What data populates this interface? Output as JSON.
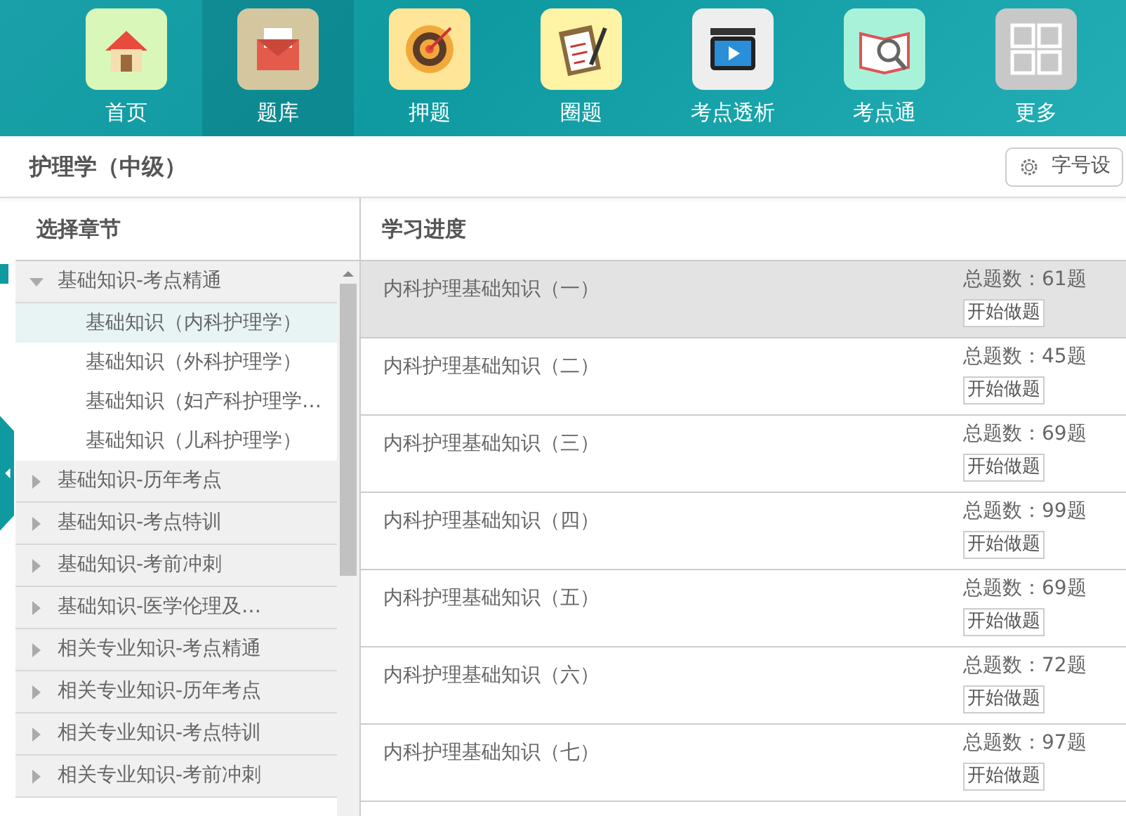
{
  "nav": [
    {
      "label": "首页",
      "selected": false
    },
    {
      "label": "题库",
      "selected": true
    },
    {
      "label": "押题",
      "selected": false
    },
    {
      "label": "圈题",
      "selected": false
    },
    {
      "label": "考点透析",
      "selected": false
    },
    {
      "label": "考点通",
      "selected": false
    },
    {
      "label": "更多",
      "selected": false
    }
  ],
  "page_title": "护理学（中级）",
  "font_size_button": "字号设",
  "sidebar": {
    "heading": "选择章节",
    "items": [
      {
        "label": "基础知识-考点精通",
        "expanded": true,
        "children": [
          {
            "label": "基础知识（内科护理学）",
            "selected": true
          },
          {
            "label": "基础知识（外科护理学）",
            "selected": false
          },
          {
            "label": "基础知识（妇产科护理学…",
            "selected": false
          },
          {
            "label": "基础知识（儿科护理学）",
            "selected": false
          }
        ]
      },
      {
        "label": "基础知识-历年考点",
        "expanded": false
      },
      {
        "label": "基础知识-考点特训",
        "expanded": false
      },
      {
        "label": "基础知识-考前冲刺",
        "expanded": false
      },
      {
        "label": "基础知识-医学伦理及…",
        "expanded": false
      },
      {
        "label": "相关专业知识-考点精通",
        "expanded": false
      },
      {
        "label": "相关专业知识-历年考点",
        "expanded": false
      },
      {
        "label": "相关专业知识-考点特训",
        "expanded": false
      },
      {
        "label": "相关专业知识-考前冲刺",
        "expanded": false
      }
    ]
  },
  "progress": {
    "heading": "学习进度",
    "rows": [
      {
        "title": "内科护理基础知识（一）",
        "total": "总题数：61题",
        "button": "开始做题",
        "selected": true
      },
      {
        "title": "内科护理基础知识（二）",
        "total": "总题数：45题",
        "button": "开始做题",
        "selected": false
      },
      {
        "title": "内科护理基础知识（三）",
        "total": "总题数：69题",
        "button": "开始做题",
        "selected": false
      },
      {
        "title": "内科护理基础知识（四）",
        "total": "总题数：99题",
        "button": "开始做题",
        "selected": false
      },
      {
        "title": "内科护理基础知识（五）",
        "total": "总题数：69题",
        "button": "开始做题",
        "selected": false
      },
      {
        "title": "内科护理基础知识（六）",
        "total": "总题数：72题",
        "button": "开始做题",
        "selected": false
      },
      {
        "title": "内科护理基础知识（七）",
        "total": "总题数：97题",
        "button": "开始做题",
        "selected": false
      }
    ]
  }
}
